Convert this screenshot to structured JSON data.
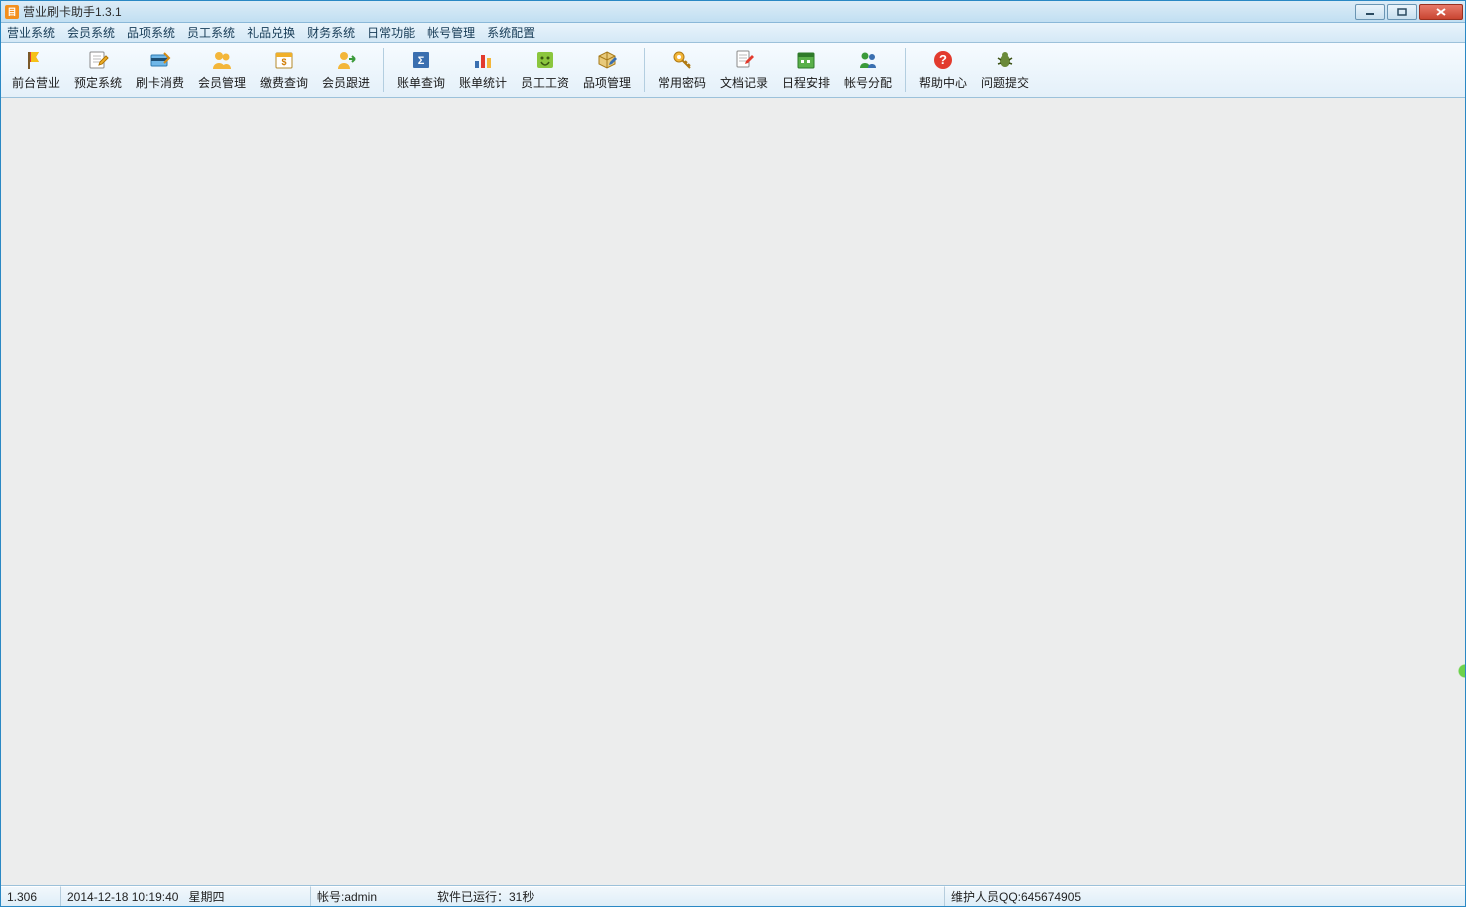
{
  "titlebar": {
    "title": "营业刷卡助手1.3.1"
  },
  "menu": {
    "items": [
      "营业系统",
      "会员系统",
      "品项系统",
      "员工系统",
      "礼品兑换",
      "财务系统",
      "日常功能",
      "帐号管理",
      "系统配置"
    ]
  },
  "toolbar": {
    "groups": [
      [
        "前台营业",
        "预定系统",
        "刷卡消费",
        "会员管理",
        "缴费查询",
        "会员跟进"
      ],
      [
        "账单查询",
        "账单统计",
        "员工工资",
        "品项管理"
      ],
      [
        "常用密码",
        "文档记录",
        "日程安排",
        "帐号分配"
      ],
      [
        "帮助中心",
        "问题提交"
      ]
    ]
  },
  "status": {
    "version": "1.306",
    "datetime": "2014-12-18 10:19:40",
    "weekday": "星期四",
    "account_label": "帐号:admin",
    "runtime": "软件已运行：31秒",
    "maintainer": "维护人员QQ:645674905"
  }
}
